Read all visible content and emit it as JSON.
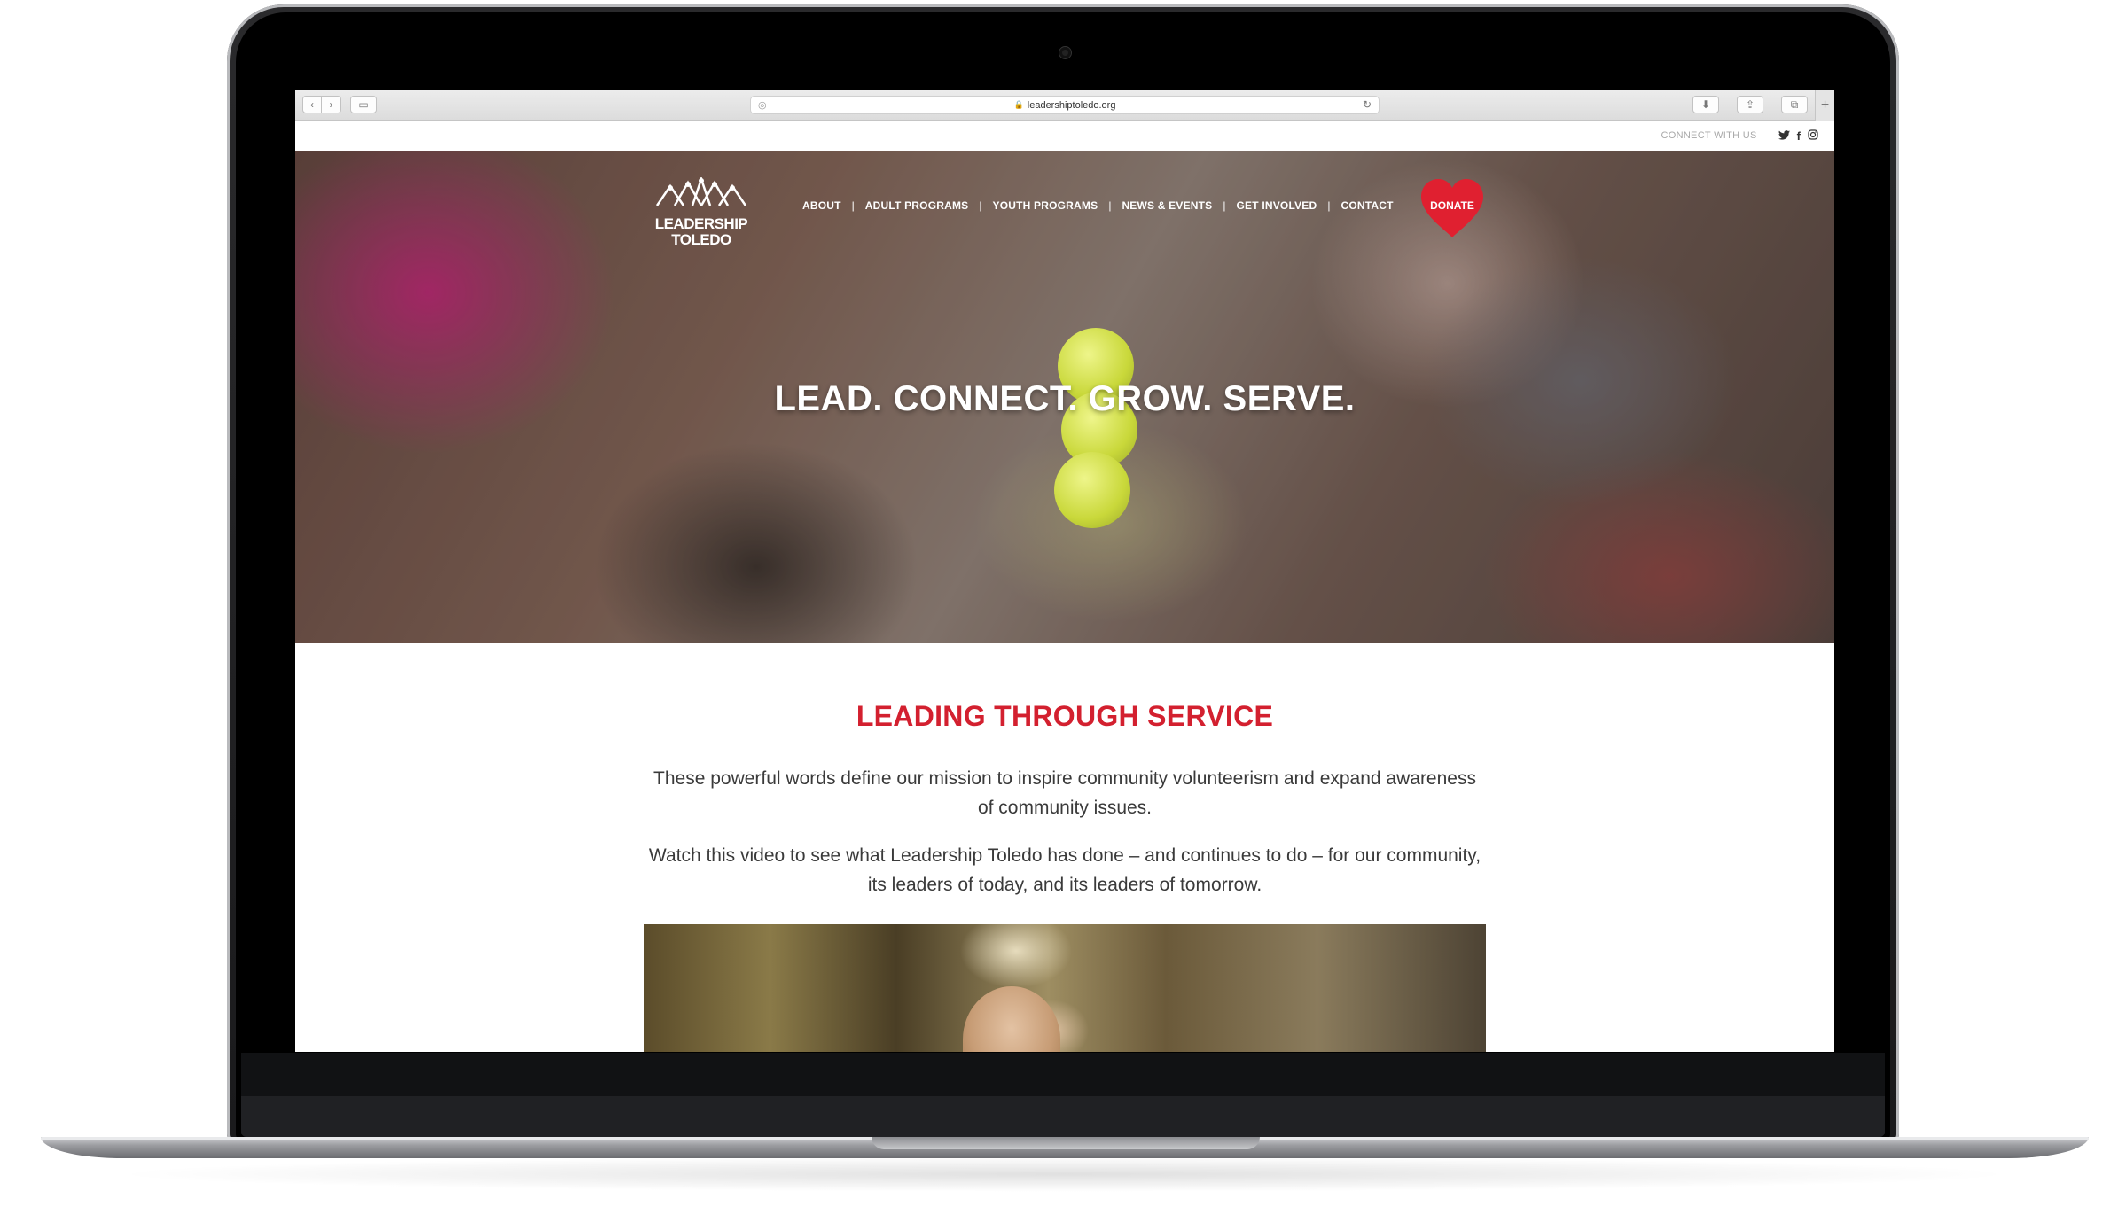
{
  "browser": {
    "url": "leadershiptoledo.org",
    "back_icon": "‹",
    "forward_icon": "›",
    "sidebar_icon": "▭",
    "reader_icon": "◎",
    "reload_icon": "↻",
    "lock_icon": "🔒",
    "download_icon": "⬇",
    "share_icon": "⇪",
    "tabs_icon": "⧉",
    "new_tab_icon": "+"
  },
  "utility": {
    "connect_label": "CONNECT WITH US",
    "social": [
      {
        "name": "twitter",
        "glyph": "🐦"
      },
      {
        "name": "facebook",
        "glyph": "f"
      },
      {
        "name": "instagram",
        "glyph": "◎"
      }
    ]
  },
  "logo": {
    "line1": "LEADERSHIP",
    "line2": "TOLEDO"
  },
  "nav": {
    "items": [
      "ABOUT",
      "ADULT PROGRAMS",
      "YOUTH PROGRAMS",
      "NEWS & EVENTS",
      "GET INVOLVED",
      "CONTACT"
    ],
    "separator": "|",
    "donate": "DONATE"
  },
  "hero": {
    "title": "LEAD. CONNECT. GROW. SERVE."
  },
  "section": {
    "title": "LEADING THROUGH SERVICE",
    "paragraph1": "These powerful words define our mission to inspire community volunteerism and expand awareness of community issues.",
    "paragraph2": "Watch this video to see what Leadership Toledo has done – and continues to do – for our community, its leaders of today, and its leaders of tomorrow."
  },
  "colors": {
    "accent_red": "#d3202f",
    "heart_red": "#e02030"
  }
}
